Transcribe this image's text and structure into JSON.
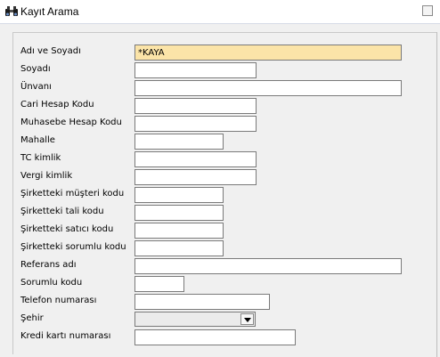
{
  "window": {
    "title": "Kayıt Arama",
    "title_icon": "binoculars-icon"
  },
  "form": {
    "fields": [
      {
        "label": "Adı ve Soyadı",
        "value": "*KAYA",
        "type": "text"
      },
      {
        "label": "Soyadı",
        "value": "",
        "type": "text"
      },
      {
        "label": "Ünvanı",
        "value": "",
        "type": "text"
      },
      {
        "label": "Cari Hesap Kodu",
        "value": "",
        "type": "text"
      },
      {
        "label": "Muhasebe Hesap Kodu",
        "value": "",
        "type": "text"
      },
      {
        "label": "Mahalle",
        "value": "",
        "type": "text"
      },
      {
        "label": "TC kimlik",
        "value": "",
        "type": "text"
      },
      {
        "label": "Vergi kimlik",
        "value": "",
        "type": "text"
      },
      {
        "label": "Şirketteki müşteri kodu",
        "value": "",
        "type": "text"
      },
      {
        "label": "Şirketteki tali kodu",
        "value": "",
        "type": "text"
      },
      {
        "label": "Şirketteki satıcı kodu",
        "value": "",
        "type": "text"
      },
      {
        "label": "Şirketteki sorumlu kodu",
        "value": "",
        "type": "text"
      },
      {
        "label": "Referans adı",
        "value": "",
        "type": "text"
      },
      {
        "label": "Sorumlu kodu",
        "value": "",
        "type": "text"
      },
      {
        "label": "Telefon numarası",
        "value": "",
        "type": "text"
      },
      {
        "label": "Şehir",
        "value": "",
        "type": "select"
      },
      {
        "label": "Kredi kartı numarası",
        "value": "",
        "type": "text"
      }
    ]
  },
  "colors": {
    "focused_field": "#fbe4a8",
    "field_border": "#7a7a7a",
    "panel_bg": "#f0f0f0"
  }
}
